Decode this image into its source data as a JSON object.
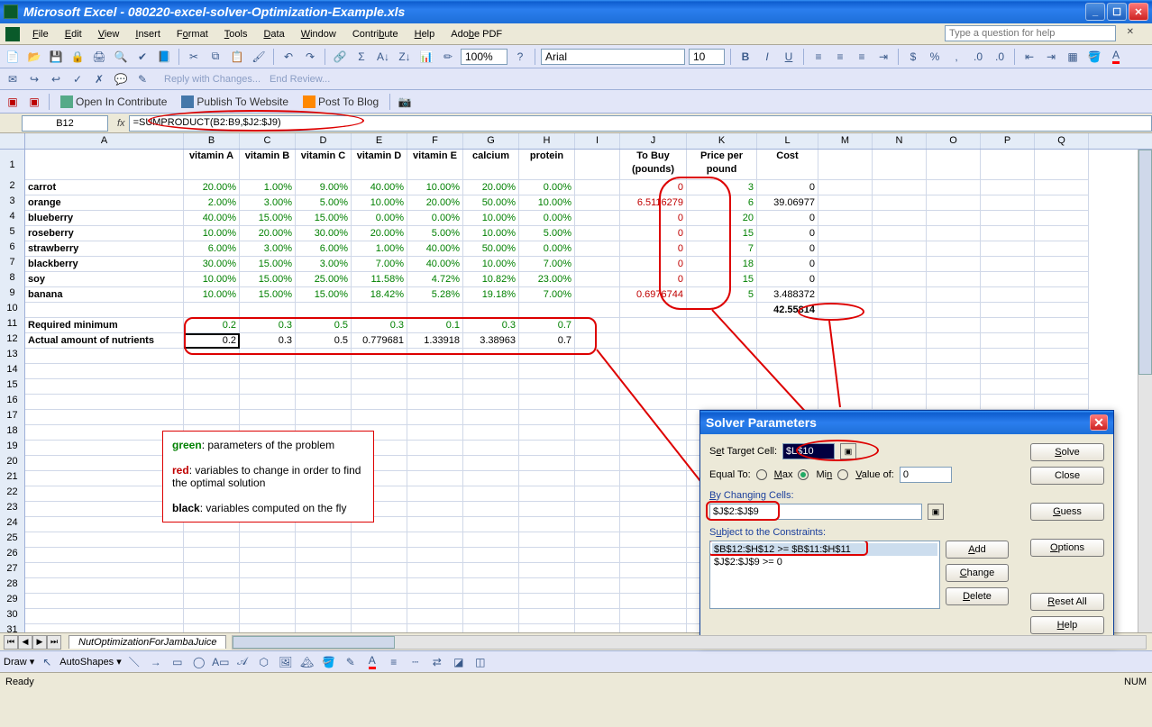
{
  "app_title": "Microsoft Excel - 080220-excel-solver-Optimization-Example.xls",
  "menus": [
    "File",
    "Edit",
    "View",
    "Insert",
    "Format",
    "Tools",
    "Data",
    "Window",
    "Contribute",
    "Help",
    "Adobe PDF"
  ],
  "help_placeholder": "Type a question for help",
  "font_name": "Arial",
  "font_size": "10",
  "zoom": "100%",
  "review": {
    "reply": "Reply with Changes...",
    "end": "End Review..."
  },
  "contribute": {
    "open": "Open In Contribute",
    "publish": "Publish To Website",
    "post": "Post To Blog"
  },
  "namebox": "B12",
  "formula": "=SUMPRODUCT(B2:B9,$J2:$J9)",
  "columns": [
    "A",
    "B",
    "C",
    "D",
    "E",
    "F",
    "G",
    "H",
    "I",
    "J",
    "K",
    "L",
    "M",
    "N",
    "O",
    "P",
    "Q"
  ],
  "headers": {
    "B": "vitamin A",
    "C": "vitamin B",
    "D": "vitamin C",
    "E": "vitamin D",
    "F": "vitamin E",
    "G": "calcium",
    "H": "protein",
    "J": "To Buy (pounds)",
    "K": "Price per pound",
    "L": "Cost"
  },
  "rows": [
    {
      "A": "carrot",
      "pct": [
        "20.00%",
        "1.00%",
        "9.00%",
        "40.00%",
        "10.00%",
        "20.00%",
        "0.00%"
      ],
      "J": "0",
      "K": "3",
      "L": "0"
    },
    {
      "A": "orange",
      "pct": [
        "2.00%",
        "3.00%",
        "5.00%",
        "10.00%",
        "20.00%",
        "50.00%",
        "10.00%"
      ],
      "J": "6.5116279",
      "K": "6",
      "L": "39.06977"
    },
    {
      "A": "blueberry",
      "pct": [
        "40.00%",
        "15.00%",
        "15.00%",
        "0.00%",
        "0.00%",
        "10.00%",
        "0.00%"
      ],
      "J": "0",
      "K": "20",
      "L": "0"
    },
    {
      "A": "roseberry",
      "pct": [
        "10.00%",
        "20.00%",
        "30.00%",
        "20.00%",
        "5.00%",
        "10.00%",
        "5.00%"
      ],
      "J": "0",
      "K": "15",
      "L": "0"
    },
    {
      "A": "strawberry",
      "pct": [
        "6.00%",
        "3.00%",
        "6.00%",
        "1.00%",
        "40.00%",
        "50.00%",
        "0.00%"
      ],
      "J": "0",
      "K": "7",
      "L": "0"
    },
    {
      "A": "blackberry",
      "pct": [
        "30.00%",
        "15.00%",
        "3.00%",
        "7.00%",
        "40.00%",
        "10.00%",
        "7.00%"
      ],
      "J": "0",
      "K": "18",
      "L": "0"
    },
    {
      "A": "soy",
      "pct": [
        "10.00%",
        "15.00%",
        "25.00%",
        "11.58%",
        "4.72%",
        "10.82%",
        "23.00%"
      ],
      "J": "0",
      "K": "15",
      "L": "0"
    },
    {
      "A": "banana",
      "pct": [
        "10.00%",
        "15.00%",
        "15.00%",
        "18.42%",
        "5.28%",
        "19.18%",
        "7.00%"
      ],
      "J": "0.6976744",
      "K": "5",
      "L": "3.488372"
    }
  ],
  "total_cost": "42.55814",
  "req_min_label": "Required minimum",
  "req_min": [
    "0.2",
    "0.3",
    "0.5",
    "0.3",
    "0.1",
    "0.3",
    "0.7"
  ],
  "actual_label": "Actual amount of nutrients",
  "actual": [
    "0.2",
    "0.3",
    "0.5",
    "0.779681",
    "1.33918",
    "3.38963",
    "0.7"
  ],
  "legend": {
    "g": "green",
    "g_t": ": parameters of the problem",
    "r": "red",
    "r_t": ": variables to change in order to find the optimal solution",
    "k": "black",
    "k_t": ": variables computed on the fly"
  },
  "solver": {
    "title": "Solver Parameters",
    "set_target": "Set Target Cell:",
    "target_val": "$L$10",
    "equal_to": "Equal To:",
    "opt_max": "Max",
    "opt_min": "Min",
    "opt_val": "Value of:",
    "valof": "0",
    "by_change": "By Changing Cells:",
    "change_val": "$J$2:$J$9",
    "subject": "Subject to the Constraints:",
    "constraints": [
      "$B$12:$H$12 >= $B$11:$H$11",
      "$J$2:$J$9 >= 0"
    ],
    "btn_solve": "Solve",
    "btn_close": "Close",
    "btn_guess": "Guess",
    "btn_options": "Options",
    "btn_add": "Add",
    "btn_change": "Change",
    "btn_delete": "Delete",
    "btn_reset": "Reset All",
    "btn_help": "Help"
  },
  "sheet_tab": "NutOptimizationForJambaJuice",
  "draw_label": "Draw",
  "autoshapes": "AutoShapes",
  "status_ready": "Ready",
  "status_num": "NUM"
}
